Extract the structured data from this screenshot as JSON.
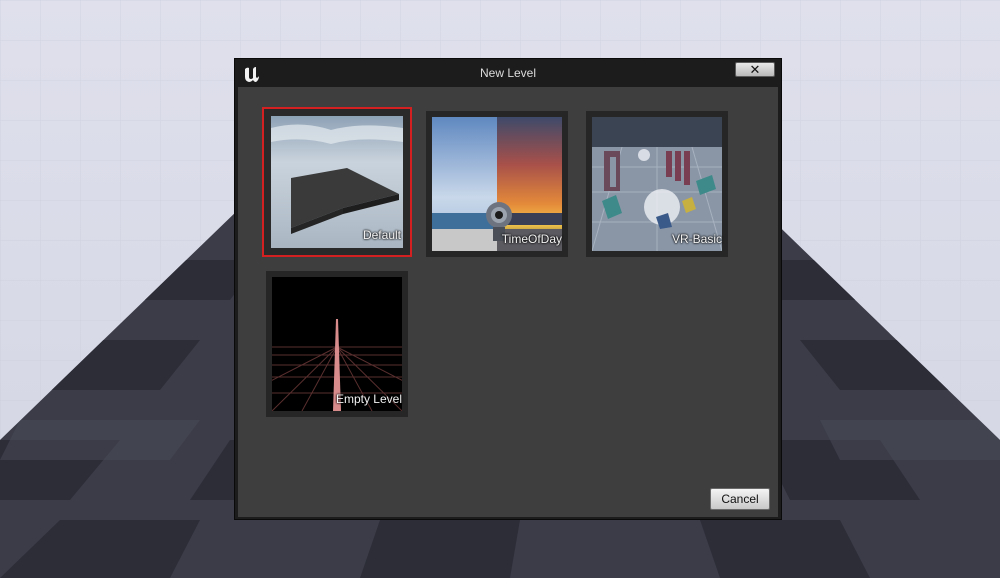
{
  "dialog": {
    "title": "New Level",
    "logo_icon": "unreal-engine-logo",
    "close_icon": "close-icon",
    "cancel_label": "Cancel"
  },
  "templates": [
    {
      "label": "Default",
      "selected": true
    },
    {
      "label": "TimeOfDay",
      "selected": false
    },
    {
      "label": "VR-Basic",
      "selected": false
    },
    {
      "label": "Empty Level",
      "selected": false
    }
  ],
  "colors": {
    "selection_border": "#d42020",
    "dialog_background": "#3e3e3e",
    "titlebar": "#1c1c1c"
  }
}
